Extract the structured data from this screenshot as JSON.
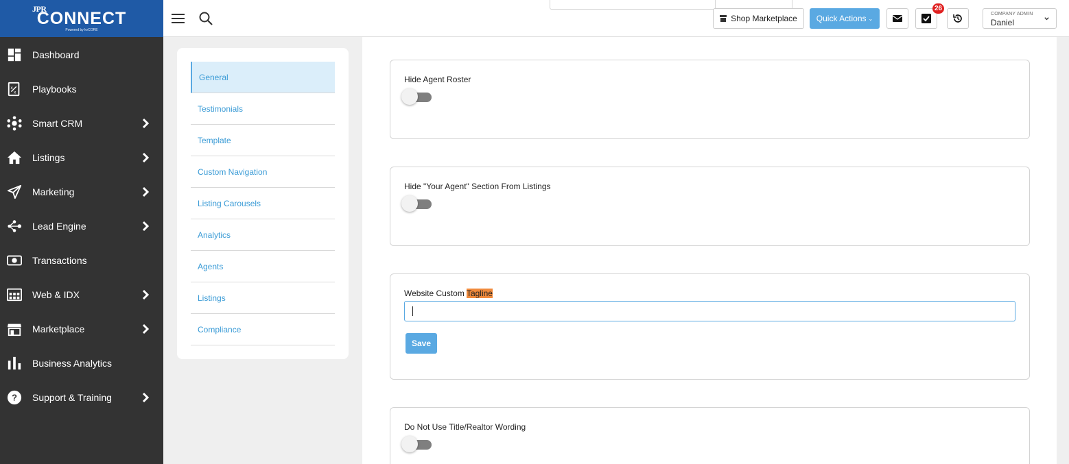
{
  "brand": {
    "small_logo_text": "JPR",
    "name": "CONNECT",
    "tagline": "Powered by kvCORE",
    "color": "#1f5aa6"
  },
  "sidebar": {
    "background": "#333333",
    "items": [
      {
        "label": "Dashboard",
        "icon": "dashboard-icon",
        "has_submenu": false
      },
      {
        "label": "Playbooks",
        "icon": "playbook-icon",
        "has_submenu": false
      },
      {
        "label": "Smart CRM",
        "icon": "crm-network-icon",
        "has_submenu": true
      },
      {
        "label": "Listings",
        "icon": "home-icon",
        "has_submenu": true
      },
      {
        "label": "Marketing",
        "icon": "paper-plane-icon",
        "has_submenu": true
      },
      {
        "label": "Lead Engine",
        "icon": "lead-engine-icon",
        "has_submenu": true
      },
      {
        "label": "Transactions",
        "icon": "transactions-icon",
        "has_submenu": false
      },
      {
        "label": "Web & IDX",
        "icon": "web-idx-icon",
        "has_submenu": true
      },
      {
        "label": "Marketplace",
        "icon": "storefront-icon",
        "has_submenu": true
      },
      {
        "label": "Business Analytics",
        "icon": "bar-chart-icon",
        "has_submenu": false
      },
      {
        "label": "Support & Training",
        "icon": "help-circle-icon",
        "has_submenu": true
      }
    ]
  },
  "topbar": {
    "shop_label": "Shop Marketplace",
    "quick_actions_label": "Quick Actions",
    "quick_actions_caret": "⌄",
    "task_count": "26",
    "user_role": "COMPANY ADMIN",
    "user_name": "Daniel",
    "accent": "#5aa9e2"
  },
  "settings_menu": {
    "items": [
      {
        "label": "General",
        "active": true
      },
      {
        "label": "Testimonials",
        "active": false
      },
      {
        "label": "Template",
        "active": false
      },
      {
        "label": "Custom Navigation",
        "active": false
      },
      {
        "label": "Listing Carousels",
        "active": false
      },
      {
        "label": "Analytics",
        "active": false
      },
      {
        "label": "Agents",
        "active": false
      },
      {
        "label": "Listings",
        "active": false
      },
      {
        "label": "Compliance",
        "active": false
      }
    ]
  },
  "settings": {
    "hide_agent_roster": {
      "label": "Hide Agent Roster",
      "enabled": false
    },
    "hide_your_agent": {
      "label": "Hide \"Your Agent\" Section From Listings",
      "enabled": false
    },
    "custom_tagline": {
      "label_prefix": "Website Custom ",
      "label_highlight": "Tagline",
      "value": "",
      "save_label": "Save"
    },
    "no_title_realtor": {
      "label": "Do Not Use Title/Realtor Wording",
      "enabled": false
    }
  }
}
